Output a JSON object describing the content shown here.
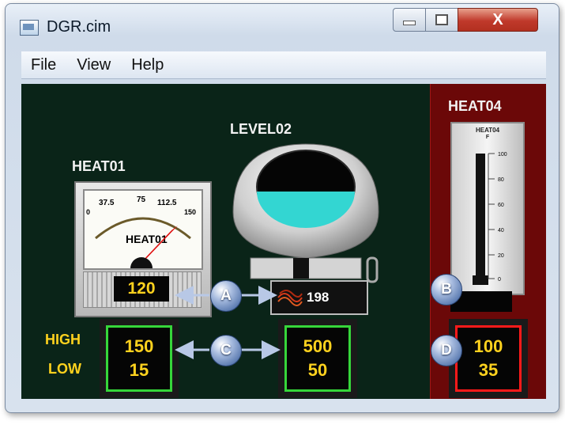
{
  "window": {
    "title": "DGR.cim",
    "close_glyph": "X"
  },
  "menu": [
    "File",
    "View",
    "Help"
  ],
  "heat01": {
    "label": "HEAT01",
    "gauge_title": "HEAT01",
    "ticks": [
      "0",
      "37.5",
      "75",
      "112.5",
      "150"
    ],
    "value": "120",
    "high": "150",
    "low": "15"
  },
  "level02": {
    "label": "LEVEL02",
    "value": "198",
    "high": "500",
    "low": "50",
    "fill_fraction": 0.35
  },
  "heat04": {
    "label": "HEAT04",
    "thermo_title": "HEAT04",
    "thermo_unit": "F",
    "scale": [
      "100",
      "80",
      "60",
      "40",
      "20",
      "0"
    ],
    "high": "100",
    "low": "35"
  },
  "limit_labels": {
    "high": "HIGH",
    "low": "LOW"
  },
  "callouts": [
    "A",
    "B",
    "C",
    "D"
  ],
  "colors": {
    "background": "#0a2418",
    "panel_red": "#6b0808",
    "lcd_text": "#ffd21e",
    "limit_border": "#36d63a",
    "limit_border_red": "#ff1a1a"
  }
}
